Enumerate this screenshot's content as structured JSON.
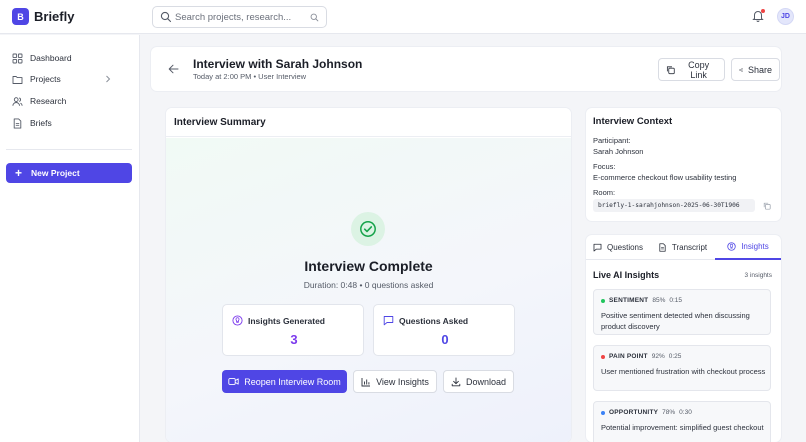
{
  "brand": {
    "logo_letter": "B",
    "name": "Briefly"
  },
  "search": {
    "placeholder": "Search projects, research..."
  },
  "user": {
    "initials": "JD"
  },
  "sidebar": {
    "items": [
      {
        "label": "Dashboard",
        "icon": "grid-icon"
      },
      {
        "label": "Projects",
        "icon": "folder-icon"
      },
      {
        "label": "Research",
        "icon": "users-icon"
      },
      {
        "label": "Briefs",
        "icon": "document-icon"
      }
    ],
    "new_project_label": "New Project"
  },
  "header": {
    "title": "Interview with Sarah Johnson",
    "subtitle": "Today at 2:00 PM • User Interview",
    "copy_link_label": "Copy Link",
    "share_label": "Share"
  },
  "summary": {
    "heading": "Interview Summary",
    "status": "Interview Complete",
    "duration_text": "Duration: 0:48 • 0 questions asked",
    "stats": [
      {
        "label": "Insights Generated",
        "value": "3",
        "color": "#7c3aed"
      },
      {
        "label": "Questions Asked",
        "value": "0",
        "color": "#4f46e5"
      }
    ],
    "actions": {
      "reopen_label": "Reopen Interview Room",
      "view_insights_label": "View Insights",
      "download_label": "Download"
    }
  },
  "context": {
    "heading": "Interview Context",
    "participant_label": "Participant:",
    "participant_value": "Sarah Johnson",
    "focus_label": "Focus:",
    "focus_value": "E-commerce checkout flow usability testing",
    "room_label": "Room:",
    "room_value": "briefly-1-sarahjohnson-2025-06-30T1906"
  },
  "panel": {
    "tabs": [
      {
        "label": "Questions",
        "active": false
      },
      {
        "label": "Transcript",
        "active": false
      },
      {
        "label": "Insights",
        "active": true
      }
    ],
    "title": "Live AI Insights",
    "count_text": "3 insights",
    "insights": [
      {
        "type": "SENTIMENT",
        "confidence": "85%",
        "time": "0:15",
        "text": "Positive sentiment detected when discussing product discovery",
        "color": "#22c55e"
      },
      {
        "type": "PAIN POINT",
        "confidence": "92%",
        "time": "0:25",
        "text": "User mentioned frustration with checkout process",
        "color": "#ef4444"
      },
      {
        "type": "OPPORTUNITY",
        "confidence": "78%",
        "time": "0:30",
        "text": "Potential improvement: simplified guest checkout",
        "color": "#3b82f6"
      }
    ]
  },
  "colors": {
    "accent": "#4f46e5",
    "success": "#16a34a"
  }
}
